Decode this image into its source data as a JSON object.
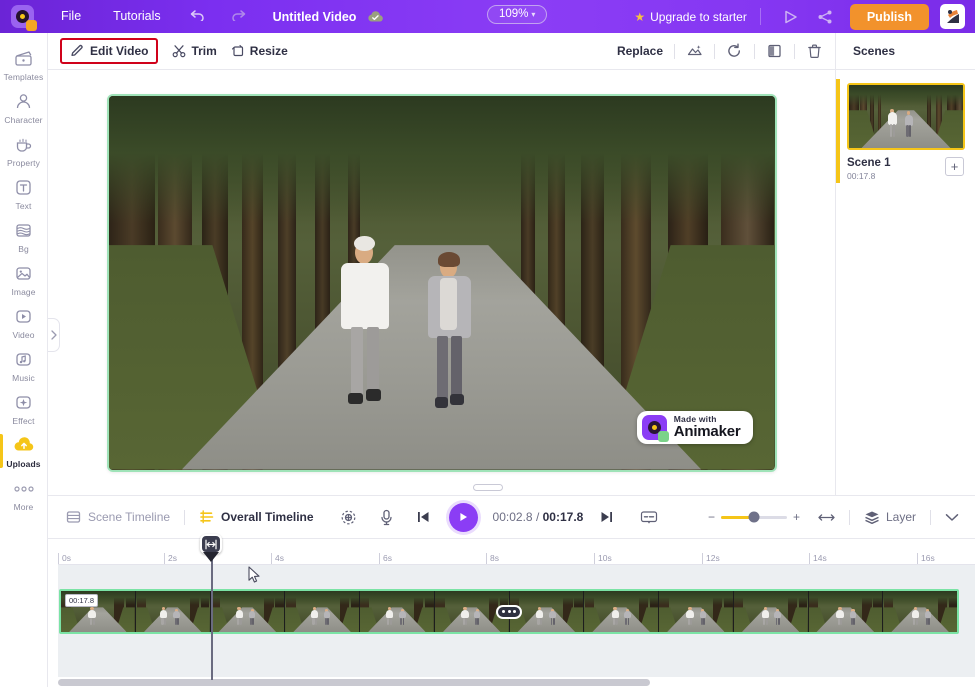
{
  "topbar": {
    "logo_icon": "animaker-logo-icon",
    "menu": [
      {
        "label": "File",
        "name": "menu-file"
      },
      {
        "label": "Tutorials",
        "name": "menu-tutorials"
      }
    ],
    "undo_icon": "undo-icon",
    "redo_icon": "redo-icon",
    "doc_title": "Untitled Video",
    "cloud_icon": "cloud-saved-icon",
    "zoom_level": "109%",
    "zoom_caret": "▾",
    "upgrade_label": "Upgrade to starter",
    "upgrade_star": "★",
    "preview_icon": "preview-play-icon",
    "share_icon": "share-icon",
    "publish_label": "Publish",
    "avatar_icon": "user-avatar-icon"
  },
  "sidebar": {
    "items": [
      {
        "label": "Templates",
        "icon": "templates-icon",
        "name": "sidebar-item-templates",
        "active": false
      },
      {
        "label": "Character",
        "icon": "character-icon",
        "name": "sidebar-item-character",
        "active": false
      },
      {
        "label": "Property",
        "icon": "property-icon",
        "name": "sidebar-item-property",
        "active": false
      },
      {
        "label": "Text",
        "icon": "text-icon",
        "name": "sidebar-item-text",
        "active": false
      },
      {
        "label": "Bg",
        "icon": "background-icon",
        "name": "sidebar-item-bg",
        "active": false
      },
      {
        "label": "Image",
        "icon": "image-icon",
        "name": "sidebar-item-image",
        "active": false
      },
      {
        "label": "Video",
        "icon": "video-icon",
        "name": "sidebar-item-video",
        "active": false
      },
      {
        "label": "Music",
        "icon": "music-icon",
        "name": "sidebar-item-music",
        "active": false
      },
      {
        "label": "Effect",
        "icon": "effect-icon",
        "name": "sidebar-item-effect",
        "active": false
      },
      {
        "label": "Uploads",
        "icon": "uploads-cloud-icon",
        "name": "sidebar-item-uploads",
        "active": true
      },
      {
        "label": "More",
        "icon": "more-dots-icon",
        "name": "sidebar-item-more",
        "active": false
      }
    ],
    "collapse_handle_icon": "chevron-right-icon"
  },
  "toolbar": {
    "edit_video_label": "Edit Video",
    "edit_video_icon": "pencil-icon",
    "trim_label": "Trim",
    "trim_icon": "scissors-icon",
    "resize_label": "Resize",
    "resize_icon": "crop-icon",
    "replace_label": "Replace",
    "adjust_icon": "adjust-magic-icon",
    "rotate_icon": "rotate-icon",
    "flip_icon": "flip-icon",
    "delete_icon": "trash-icon",
    "scenes_label": "Scenes",
    "highlight_color": "#d0021b"
  },
  "canvas": {
    "selection_color": "#9fe3b8",
    "watermark": {
      "made_with": "Made with",
      "brand": "Animaker",
      "logo_icon": "animaker-watermark-logo-icon"
    },
    "resize_handle_icon": "drag-handle-icon"
  },
  "scenes": {
    "cards": [
      {
        "title": "Scene 1",
        "duration": "00:17.8",
        "name": "scene-card-1"
      }
    ],
    "add_label": "+",
    "active_color": "#f5c518"
  },
  "timeline": {
    "scene_tab_label": "Scene Timeline",
    "scene_tab_icon": "scene-timeline-icon",
    "overall_tab_label": "Overall Timeline",
    "overall_tab_icon": "overall-timeline-icon",
    "focus_icon": "focus-target-icon",
    "mic_icon": "microphone-icon",
    "prev_icon": "skip-previous-icon",
    "play_icon": "play-icon",
    "current_time": "00:02.8",
    "time_separator": "/",
    "total_time": "00:17.8",
    "next_icon": "skip-next-icon",
    "subtitle_icon": "subtitle-icon",
    "zoom_minus": "−",
    "zoom_plus": "+",
    "fit_icon": "fit-width-icon",
    "layer_label": "Layer",
    "layer_icon": "layers-icon",
    "expand_icon": "chevron-down-icon",
    "ruler_ticks": [
      "0s",
      "2s",
      "4s",
      "6s",
      "8s",
      "10s",
      "12s",
      "14s",
      "16s"
    ],
    "clip": {
      "duration_badge": "00:17.8",
      "frame_count": 12,
      "grip_icon": "clip-drag-grip-icon",
      "border_color": "#7be3a5"
    },
    "playhead_icon": "playhead-handle-icon",
    "cursor_icon": "mouse-cursor-icon",
    "scrollbar_name": "timeline-horizontal-scrollbar"
  }
}
